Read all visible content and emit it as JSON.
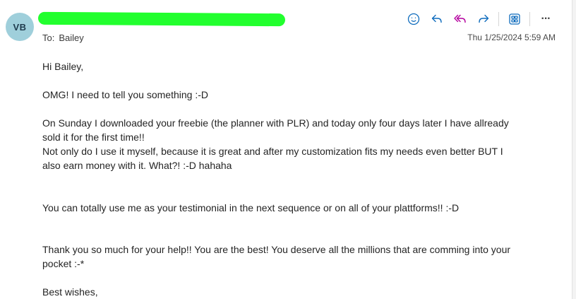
{
  "message": {
    "avatar_initials": "VB",
    "sender_display": "",
    "to_label": "To:",
    "recipient": "Bailey",
    "date": "Thu 1/25/2024 5:59 AM"
  },
  "toolbar": {
    "icons": [
      "emoji-reaction-icon",
      "reply-icon",
      "reply-all-icon",
      "forward-icon",
      "immersive-reader-icon",
      "more-actions-icon"
    ],
    "more_label": "···",
    "accent_color": "#0f6cbd",
    "reply_all_color": "#b4009e"
  },
  "body": {
    "greeting": "Hi Bailey,",
    "p1": "OMG! I need to tell you something :-D",
    "p2_line1": "On Sunday I downloaded your freebie (the planner with PLR) and today only four days later I have allready",
    "p2_line2": "sold it for the first time!!",
    "p2_line3": "Not only do I use it myself, because it is great and after my customization fits my needs even better BUT I",
    "p2_line4": "also earn money with it. What?! :-D hahaha",
    "p3": "You can totally use me as your testimonial in the next sequence or on all of your plattforms!! :-D",
    "p4_line1": "Thank you so much for your help!! You are the best! You deserve all the millions that are comming into your",
    "p4_line2": "pocket :-*",
    "closing": "Best wishes,"
  },
  "colors": {
    "avatar_bg": "#9fcfdb",
    "redaction": "#22ff2e"
  }
}
